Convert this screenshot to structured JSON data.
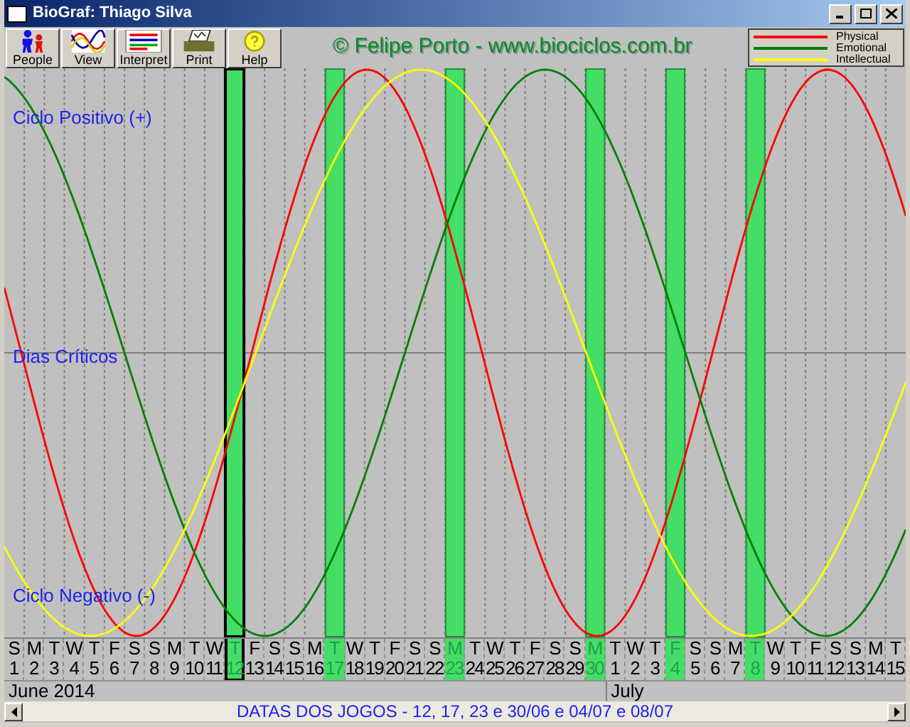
{
  "window": {
    "title": "BioGraf: Thiago Silva"
  },
  "toolbar": [
    {
      "label": "People",
      "kind": "people"
    },
    {
      "label": "View",
      "kind": "view"
    },
    {
      "label": "Interpret",
      "kind": "interpret"
    },
    {
      "label": "Print",
      "kind": "print"
    },
    {
      "label": "Help",
      "kind": "help"
    }
  ],
  "credit": "© Felipe Porto - www.biociclos.com.br",
  "legend": [
    {
      "label": "Physical",
      "kind": "physical",
      "color": "#ff0000"
    },
    {
      "label": "Emotional",
      "kind": "emotional",
      "color": "#008000"
    },
    {
      "label": "Intellectual",
      "kind": "intellectual",
      "color": "#ffff00"
    }
  ],
  "chart_labels": {
    "positive": "Ciclo Positivo (+)",
    "critical": "Dias Críticos",
    "negative": "Ciclo Negativo (-)"
  },
  "days": [
    {
      "weekday": "S",
      "day": "1",
      "highlighted": false,
      "selected": false,
      "month": "June 2014"
    },
    {
      "weekday": "M",
      "day": "2",
      "highlighted": false,
      "selected": false
    },
    {
      "weekday": "T",
      "day": "3",
      "highlighted": false,
      "selected": false
    },
    {
      "weekday": "W",
      "day": "4",
      "highlighted": false,
      "selected": false
    },
    {
      "weekday": "T",
      "day": "5",
      "highlighted": false,
      "selected": false
    },
    {
      "weekday": "F",
      "day": "6",
      "highlighted": false,
      "selected": false
    },
    {
      "weekday": "S",
      "day": "7",
      "highlighted": false,
      "selected": false
    },
    {
      "weekday": "S",
      "day": "8",
      "highlighted": false,
      "selected": false
    },
    {
      "weekday": "M",
      "day": "9",
      "highlighted": false,
      "selected": false
    },
    {
      "weekday": "T",
      "day": "10",
      "highlighted": false,
      "selected": false
    },
    {
      "weekday": "W",
      "day": "11",
      "highlighted": false,
      "selected": false
    },
    {
      "weekday": "T",
      "day": "12",
      "highlighted": true,
      "selected": true
    },
    {
      "weekday": "F",
      "day": "13",
      "highlighted": false,
      "selected": false
    },
    {
      "weekday": "S",
      "day": "14",
      "highlighted": false,
      "selected": false
    },
    {
      "weekday": "S",
      "day": "15",
      "highlighted": false,
      "selected": false
    },
    {
      "weekday": "M",
      "day": "16",
      "highlighted": false,
      "selected": false
    },
    {
      "weekday": "T",
      "day": "17",
      "highlighted": true,
      "selected": false
    },
    {
      "weekday": "W",
      "day": "18",
      "highlighted": false,
      "selected": false
    },
    {
      "weekday": "T",
      "day": "19",
      "highlighted": false,
      "selected": false
    },
    {
      "weekday": "F",
      "day": "20",
      "highlighted": false,
      "selected": false
    },
    {
      "weekday": "S",
      "day": "21",
      "highlighted": false,
      "selected": false
    },
    {
      "weekday": "S",
      "day": "22",
      "highlighted": false,
      "selected": false
    },
    {
      "weekday": "M",
      "day": "23",
      "highlighted": true,
      "selected": false
    },
    {
      "weekday": "T",
      "day": "24",
      "highlighted": false,
      "selected": false
    },
    {
      "weekday": "W",
      "day": "25",
      "highlighted": false,
      "selected": false
    },
    {
      "weekday": "T",
      "day": "26",
      "highlighted": false,
      "selected": false
    },
    {
      "weekday": "F",
      "day": "27",
      "highlighted": false,
      "selected": false
    },
    {
      "weekday": "S",
      "day": "28",
      "highlighted": false,
      "selected": false
    },
    {
      "weekday": "S",
      "day": "29",
      "highlighted": false,
      "selected": false
    },
    {
      "weekday": "M",
      "day": "30",
      "highlighted": true,
      "selected": false
    },
    {
      "weekday": "T",
      "day": "1",
      "highlighted": false,
      "selected": false,
      "month": "July"
    },
    {
      "weekday": "W",
      "day": "2",
      "highlighted": false,
      "selected": false
    },
    {
      "weekday": "T",
      "day": "3",
      "highlighted": false,
      "selected": false
    },
    {
      "weekday": "F",
      "day": "4",
      "highlighted": true,
      "selected": false
    },
    {
      "weekday": "S",
      "day": "5",
      "highlighted": false,
      "selected": false
    },
    {
      "weekday": "S",
      "day": "6",
      "highlighted": false,
      "selected": false
    },
    {
      "weekday": "M",
      "day": "7",
      "highlighted": false,
      "selected": false
    },
    {
      "weekday": "T",
      "day": "8",
      "highlighted": true,
      "selected": false
    },
    {
      "weekday": "W",
      "day": "9",
      "highlighted": false,
      "selected": false
    },
    {
      "weekday": "T",
      "day": "10",
      "highlighted": false,
      "selected": false
    },
    {
      "weekday": "F",
      "day": "11",
      "highlighted": false,
      "selected": false
    },
    {
      "weekday": "S",
      "day": "12",
      "highlighted": false,
      "selected": false
    },
    {
      "weekday": "S",
      "day": "13",
      "highlighted": false,
      "selected": false
    },
    {
      "weekday": "M",
      "day": "14",
      "highlighted": false,
      "selected": false
    },
    {
      "weekday": "T",
      "day": "15",
      "highlighted": false,
      "selected": false
    }
  ],
  "status_bar": {
    "text": "DATAS DOS JOGOS - 12, 17, 23 e 30/06 e 04/07 e 08/07"
  }
}
